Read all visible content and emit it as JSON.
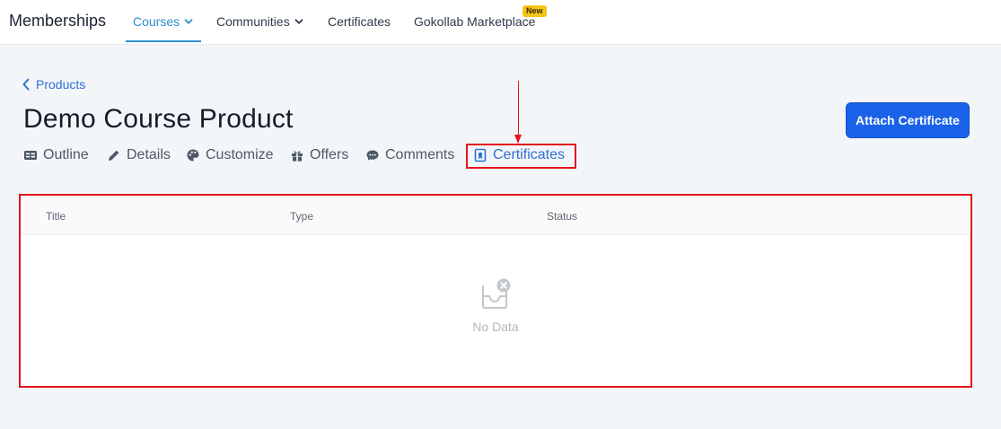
{
  "topbar": {
    "brand": "Memberships",
    "nav": [
      {
        "label": "Courses",
        "active": true,
        "has_dropdown": true
      },
      {
        "label": "Communities",
        "active": false,
        "has_dropdown": true
      },
      {
        "label": "Certificates",
        "active": false,
        "has_dropdown": false
      },
      {
        "label": "Gokollab Marketplace",
        "active": false,
        "has_dropdown": false,
        "badge": "New"
      }
    ]
  },
  "breadcrumb": {
    "back_label": "Products",
    "icon": "chevron-left-icon"
  },
  "page": {
    "title": "Demo Course Product",
    "primary_action": "Attach Certificate"
  },
  "tabs": [
    {
      "label": "Outline",
      "icon": "outline-icon",
      "active": false
    },
    {
      "label": "Details",
      "icon": "pencil-icon",
      "active": false
    },
    {
      "label": "Customize",
      "icon": "palette-icon",
      "active": false
    },
    {
      "label": "Offers",
      "icon": "gift-icon",
      "active": false
    },
    {
      "label": "Comments",
      "icon": "comment-icon",
      "active": false
    },
    {
      "label": "Certificates",
      "icon": "certificate-icon",
      "active": true
    }
  ],
  "table": {
    "columns": [
      "Title",
      "Type",
      "Status"
    ],
    "empty_text": "No Data"
  },
  "colors": {
    "accent": "#2b8ccf",
    "primary_button": "#1a63e8",
    "annotation_red": "#e3141c",
    "badge": "#f5c518"
  }
}
